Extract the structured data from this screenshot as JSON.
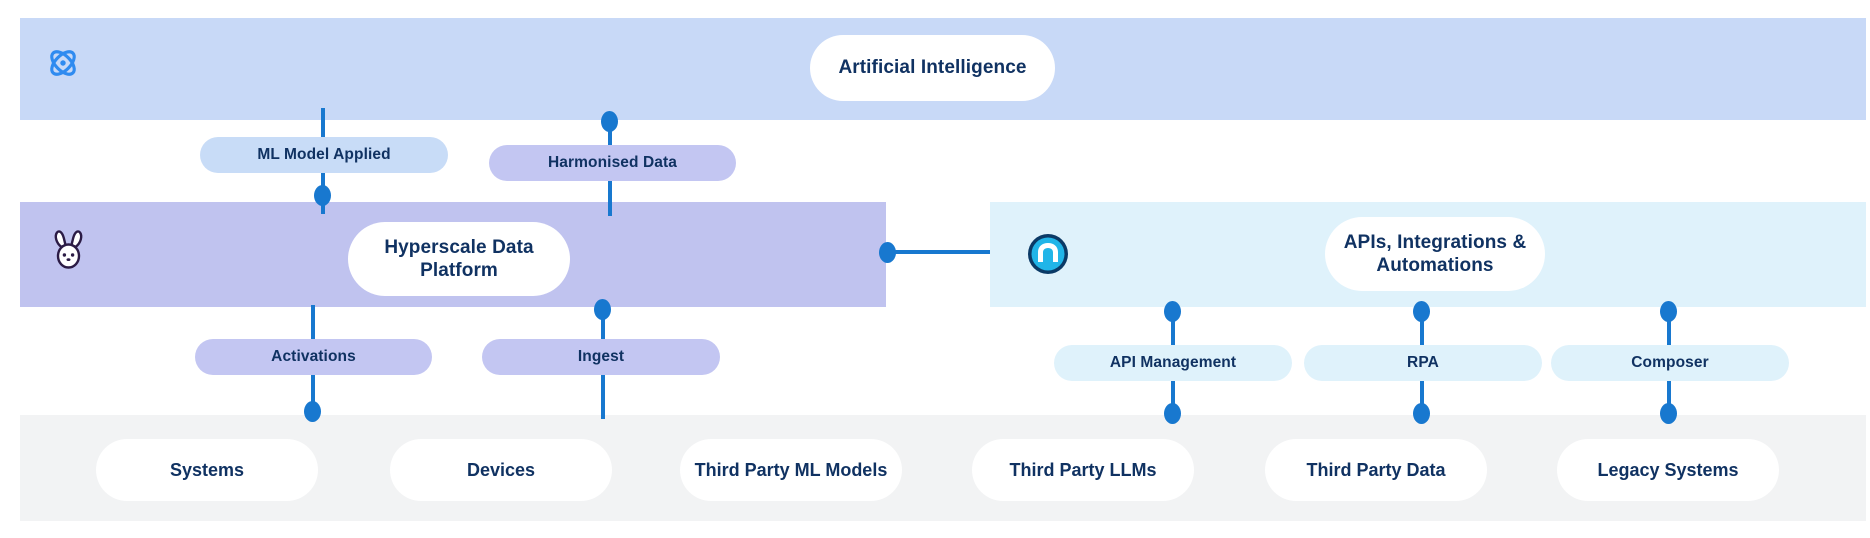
{
  "bands": [
    {
      "id": "ai",
      "title": "Artificial Intelligence",
      "icon": "atom-icon",
      "color": "#c8d9f7"
    },
    {
      "id": "hdp",
      "title": "Hyperscale Data Platform",
      "icon": "bunny-icon",
      "color": "#c0c3ef"
    },
    {
      "id": "apis",
      "title": "APIs, Integrations & Automations",
      "icon": "mulesoft-icon",
      "color": "#dff2fb"
    },
    {
      "id": "bottom",
      "title": "",
      "icon": "",
      "color": "#f2f3f4"
    }
  ],
  "band_titles": {
    "ai": "Artificial Intelligence",
    "hdp": "Hyperscale Data Platform",
    "apis": "APIs, Integrations & Automations"
  },
  "chips": {
    "ml_model_applied": "ML Model Applied",
    "harmonised_data": "Harmonised Data",
    "activations": "Activations",
    "ingest": "Ingest",
    "api_management": "API Management",
    "rpa": "RPA",
    "composer": "Composer"
  },
  "cards": [
    {
      "label": "Systems"
    },
    {
      "label": "Devices"
    },
    {
      "label": "Third Party ML Models"
    },
    {
      "label": "Third Party LLMs"
    },
    {
      "label": "Third Party Data"
    },
    {
      "label": "Legacy Systems"
    }
  ],
  "colors": {
    "ai_band": "#c8d9f7",
    "hdp_band": "#c0c3ef",
    "apis_band": "#dff2fb",
    "bottom_band": "#f2f3f4",
    "connector": "#1878cf",
    "text": "#103262",
    "chip_blue": "#c8dcf7",
    "chip_purple": "#c3c6f2",
    "chip_cyan": "#dff2fb"
  }
}
